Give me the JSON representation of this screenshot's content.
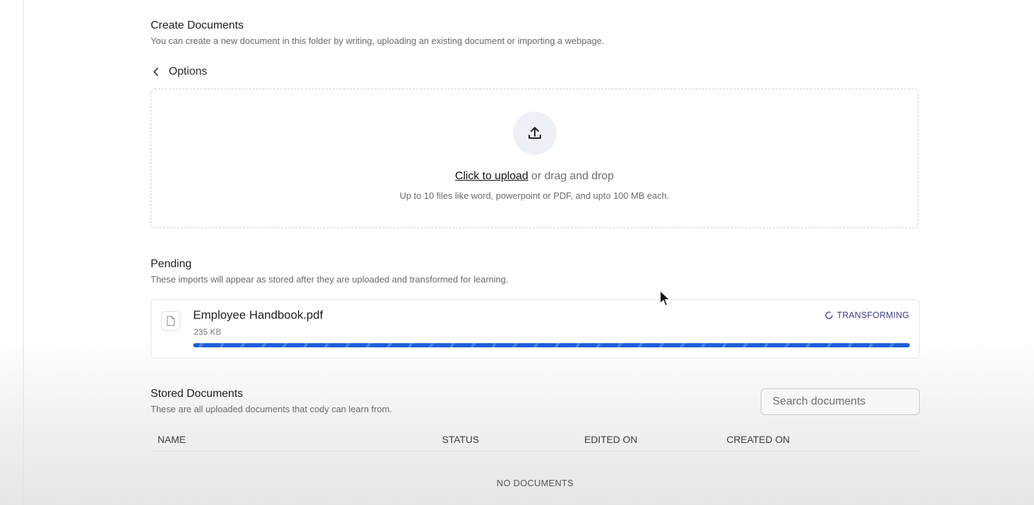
{
  "create": {
    "title": "Create Documents",
    "description": "You can create a new document in this folder by writing, uploading an existing document or importing a webpage.",
    "back_label": "Options"
  },
  "upload": {
    "link_label": "Click to upload",
    "drag_text": " or drag and drop",
    "hint": "Up to 10 files like word, powerpoint or PDF, and upto 100 MB each.",
    "icon": "upload-icon"
  },
  "pending": {
    "title": "Pending",
    "description": "These imports will appear as stored after they are uploaded and transformed for learning.",
    "items": [
      {
        "file_name": "Employee Handbook.pdf",
        "file_size": "235 KB",
        "status": "TRANSFORMING",
        "progress": 1.0,
        "icon": "file-icon"
      }
    ]
  },
  "stored": {
    "title": "Stored Documents",
    "description": "These are all uploaded documents that cody can learn from.",
    "search_placeholder": "Search documents",
    "columns": [
      "NAME",
      "STATUS",
      "EDITED ON",
      "CREATED ON"
    ],
    "empty_text": "NO DOCUMENTS"
  },
  "colors": {
    "accent": "#1f5fd6",
    "status_text": "#3c3f8f",
    "upload_circle_bg": "#eef0f7"
  }
}
